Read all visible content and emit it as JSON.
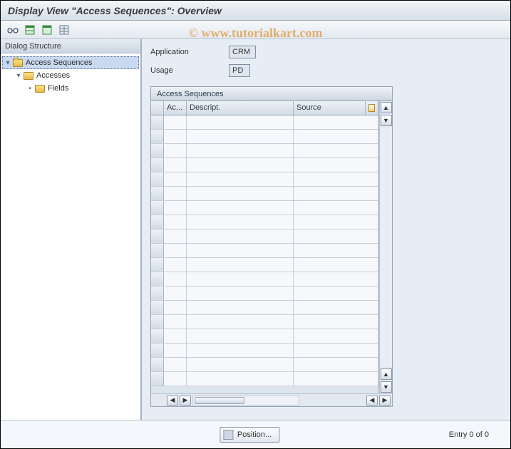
{
  "title": "Display View \"Access Sequences\": Overview",
  "watermark": "© www.tutorialkart.com",
  "toolbar": {
    "icons": [
      "glasses-toggle-icon",
      "table-expand-icon",
      "table-collapse-icon",
      "table-settings-icon"
    ]
  },
  "tree": {
    "header": "Dialog Structure",
    "nodes": [
      {
        "label": "Access Sequences",
        "level": 0,
        "expanded": true,
        "selected": true
      },
      {
        "label": "Accesses",
        "level": 1,
        "expanded": true,
        "selected": false
      },
      {
        "label": "Fields",
        "level": 2,
        "expanded": false,
        "selected": false
      }
    ]
  },
  "form": {
    "application": {
      "label": "Application",
      "value": "CRM"
    },
    "usage": {
      "label": "Usage",
      "value": "PD"
    }
  },
  "table": {
    "title": "Access Sequences",
    "columns": {
      "sel": "",
      "ac": "Ac...",
      "descript": "Descript.",
      "source": "Source"
    },
    "row_count": 19
  },
  "footer": {
    "position_label": "Position...",
    "entry_text": "Entry 0 of 0"
  }
}
